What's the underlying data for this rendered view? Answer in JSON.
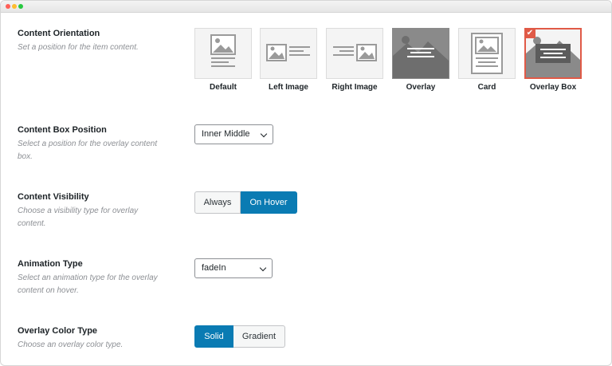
{
  "settings": {
    "orientation": {
      "label": "Content Orientation",
      "description": "Set a position for the item content.",
      "options": [
        {
          "label": "Default",
          "icon": "default-layout-icon"
        },
        {
          "label": "Left Image",
          "icon": "left-image-layout-icon"
        },
        {
          "label": "Right Image",
          "icon": "right-image-layout-icon"
        },
        {
          "label": "Overlay",
          "icon": "overlay-layout-icon"
        },
        {
          "label": "Card",
          "icon": "card-layout-icon"
        },
        {
          "label": "Overlay Box",
          "icon": "overlay-box-layout-icon"
        }
      ],
      "selected": "Overlay Box"
    },
    "box_position": {
      "label": "Content Box Position",
      "description": "Select a position for the overlay content box.",
      "value": "Inner Middle"
    },
    "visibility": {
      "label": "Content Visibility",
      "description": "Choose a visibility type for overlay content.",
      "options": [
        "Always",
        "On Hover"
      ],
      "selected": "On Hover"
    },
    "animation": {
      "label": "Animation Type",
      "description": "Select an animation type for the overlay content on hover.",
      "value": "fadeIn"
    },
    "color_type": {
      "label": "Overlay Color Type",
      "description": "Choose an overlay color type.",
      "options": [
        "Solid",
        "Gradient"
      ],
      "selected": "Solid"
    }
  },
  "colors": {
    "accent": "#0a7bb3",
    "selected_border": "#e05a47"
  }
}
